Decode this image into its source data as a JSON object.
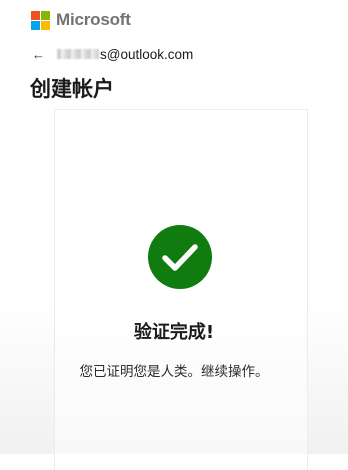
{
  "brand": {
    "name": "Microsoft",
    "colors": {
      "red": "#f25022",
      "green": "#7fba00",
      "blue": "#00a4ef",
      "yellow": "#ffb900",
      "text": "#737373"
    }
  },
  "identity": {
    "back_icon": "←",
    "email_visible": "s@outlook.com"
  },
  "page": {
    "title": "创建帐户"
  },
  "status": {
    "icon": "checkmark-circle-icon",
    "color": "#107c10",
    "title": "验证完成!",
    "message": "您已证明您是人类。继续操作。"
  }
}
